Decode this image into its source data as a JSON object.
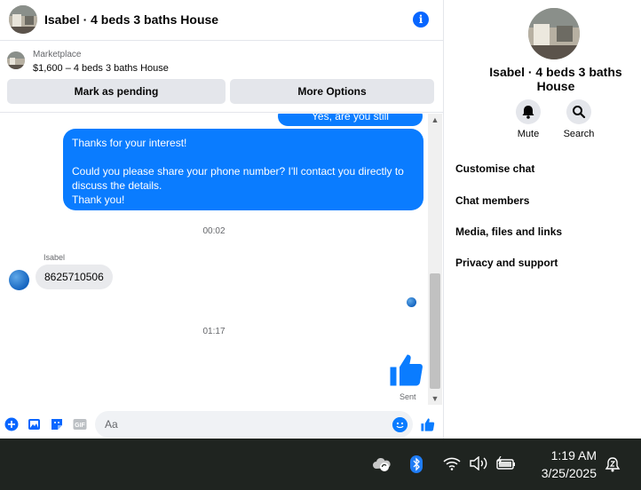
{
  "header": {
    "title": "Isabel · 4 beds 3 baths House"
  },
  "listing": {
    "source": "Marketplace",
    "title": "$1,600 – 4 beds 3 baths House",
    "pending_label": "Mark as pending",
    "more_label": "More Options"
  },
  "messages": {
    "previous_outgoing": "Yes, are you still interested?",
    "outgoing_main": "Thanks for your interest!\n\nCould you please share your phone number? I'll contact you directly to discuss the details.\nThank you!",
    "timestamp_1": "00:02",
    "sender_name": "Isabel",
    "incoming": "8625710506",
    "timestamp_2": "01:17",
    "sent_status": "Sent"
  },
  "composer": {
    "placeholder": "Aa"
  },
  "info_panel": {
    "name": "Isabel · 4 beds 3 baths House",
    "mute_label": "Mute",
    "search_label": "Search",
    "menu": [
      "Customise chat",
      "Chat members",
      "Media, files and links",
      "Privacy and support"
    ]
  },
  "taskbar": {
    "time": "1:19 AM",
    "date": "3/25/2025"
  },
  "colors": {
    "accent": "#0a7cff",
    "icon_blue": "#0866ff",
    "taskbar": "#1f2420"
  }
}
